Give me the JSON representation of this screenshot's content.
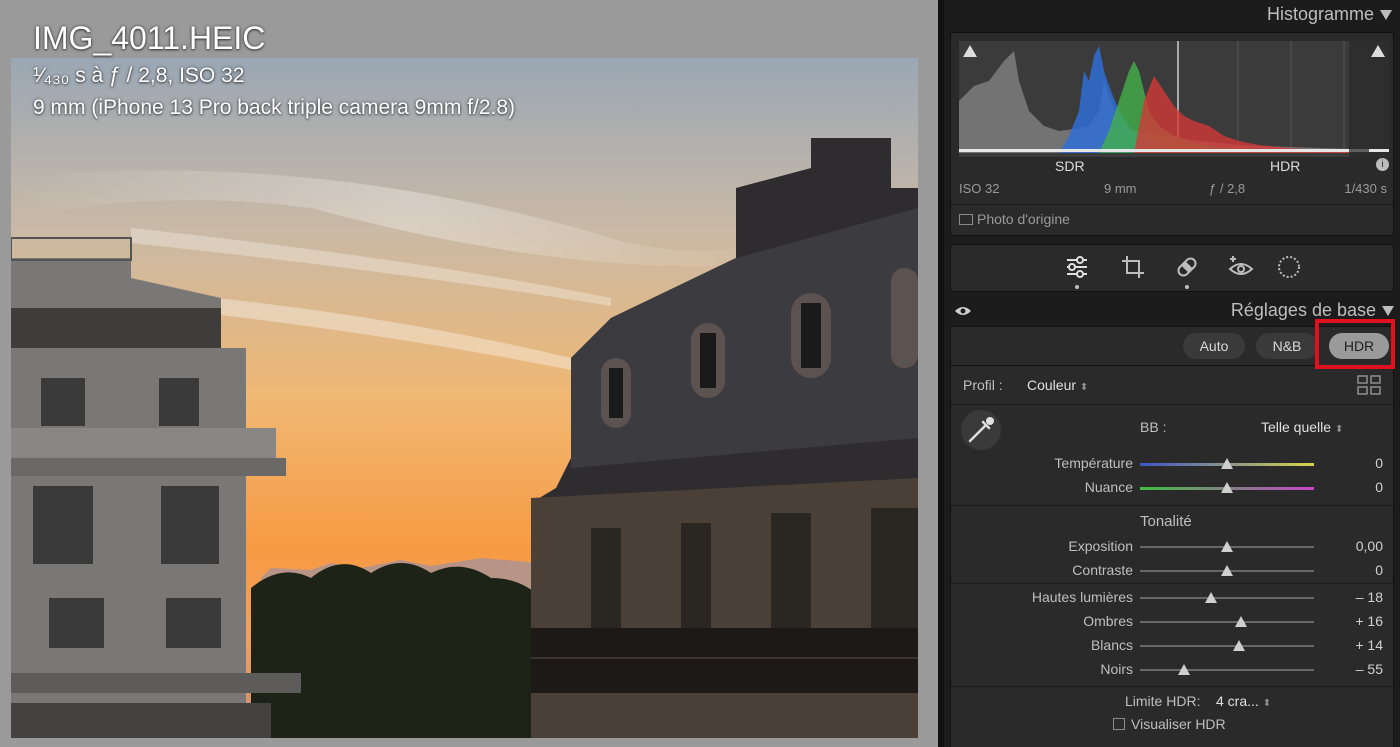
{
  "photo": {
    "filename": "IMG_4011.HEIC",
    "exposure_prefix": "¹⁄₄₃₀",
    "exposure_rest": "s à ƒ / 2,8, ISO 32",
    "lens_line": "9 mm (iPhone 13 Pro back triple camera 9mm f/2.8)"
  },
  "histogram": {
    "title": "Histogramme",
    "sdr_label": "SDR",
    "hdr_label": "HDR",
    "iso": "ISO 32",
    "focal": "9 mm",
    "aperture": "ƒ / 2,8",
    "shutter": "1/430 s",
    "original_label": "Photo d'origine",
    "colors": {
      "blue": "#2f6fd6",
      "green": "#43b04a",
      "red": "#d23a38",
      "gray": "#9a9a9a"
    }
  },
  "tools": [
    "adjust-icon",
    "crop-icon",
    "heal-icon",
    "redeye-icon",
    "mask-icon"
  ],
  "basic": {
    "title": "Réglages de base",
    "buttons": {
      "auto": "Auto",
      "nb": "N&B",
      "hdr": "HDR"
    },
    "profile_label": "Profil :",
    "profile_value": "Couleur",
    "wb_label": "BB :",
    "wb_value": "Telle quelle",
    "tone_title": "Tonalité",
    "hdr_limit_label": "Limite HDR:",
    "hdr_limit_value": "4 cra...",
    "visualize_label": "Visualiser HDR"
  },
  "sliders": {
    "temperature": {
      "label": "Température",
      "value": "0",
      "pos": 0.5
    },
    "nuance": {
      "label": "Nuance",
      "value": "0",
      "pos": 0.5
    },
    "exposition": {
      "label": "Exposition",
      "value": "0,00",
      "pos": 0.5
    },
    "contraste": {
      "label": "Contraste",
      "value": "0",
      "pos": 0.5
    },
    "hautes": {
      "label": "Hautes lumières",
      "value": "– 18",
      "pos": 0.41
    },
    "ombres": {
      "label": "Ombres",
      "value": "+ 16",
      "pos": 0.58
    },
    "blancs": {
      "label": "Blancs",
      "value": "+ 14",
      "pos": 0.57
    },
    "noirs": {
      "label": "Noirs",
      "value": "– 55",
      "pos": 0.25
    }
  }
}
